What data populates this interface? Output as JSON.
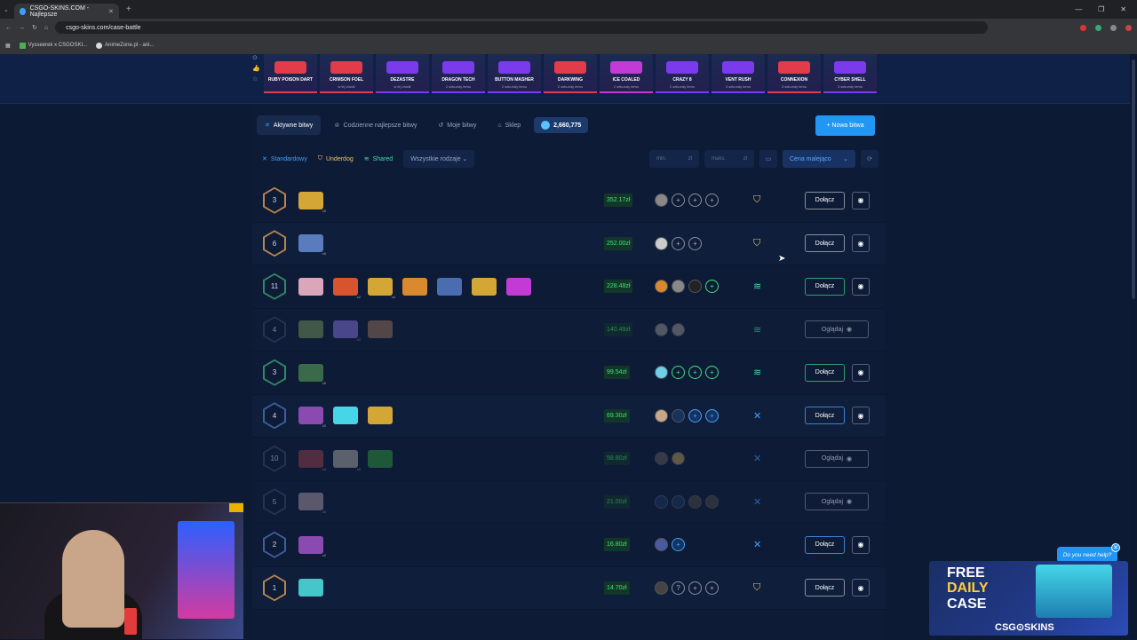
{
  "browser": {
    "tab_title": "CSGO-SKINS.COM - Najlepsze",
    "url": "csgo-skins.com/case-battle",
    "bookmarks": [
      "Vysseerek x CSGOSKI...",
      "AnimeZone.pl - ani..."
    ]
  },
  "live_drops": [
    {
      "name": "RUBY POISON DART",
      "sub": "",
      "color": "#e23b4a"
    },
    {
      "name": "CRIMSON FOEL",
      "sub": "w lej chwili",
      "color": "#e23b4a"
    },
    {
      "name": "DEZASTRE",
      "sub": "w lej chwili",
      "color": "#7c3aed"
    },
    {
      "name": "DRAGON TECH",
      "sub": "2 sekundy temu",
      "color": "#7c3aed"
    },
    {
      "name": "BUTTON MASHER",
      "sub": "2 sekundy temu",
      "color": "#7c3aed"
    },
    {
      "name": "DARKWING",
      "sub": "2 sekundy temu",
      "color": "#e23b4a"
    },
    {
      "name": "ICE COALED",
      "sub": "2 sekundy temu",
      "color": "#c23bd4"
    },
    {
      "name": "CRAZY 8",
      "sub": "2 sekundy temu",
      "color": "#7c3aed"
    },
    {
      "name": "VENT RUSH",
      "sub": "3 sekundy temu",
      "color": "#7c3aed"
    },
    {
      "name": "CONNEXION",
      "sub": "3 sekundy temu",
      "color": "#e23b4a"
    },
    {
      "name": "CYBER SHELL",
      "sub": "3 sekundy temu",
      "color": "#7c3aed"
    }
  ],
  "toolbar": {
    "active_tab": "Aktywne bitwy",
    "tab2": "Codzienne najlepsze bitwy",
    "tab3": "Moje bitwy",
    "tab4": "Sklep",
    "balance": "2,660,775",
    "new_battle": "+ Nowa bitwa"
  },
  "filters": {
    "standard": "Standardowy",
    "underdog": "Underdog",
    "shared": "Shared",
    "type_select": "Wszystkie rodzaje",
    "min": "min.",
    "max": "maks.",
    "currency": "zł",
    "sort": "Cena malejąco"
  },
  "battles": [
    {
      "round": "3",
      "hex": "gold",
      "cases": [
        [
          "#d4a636",
          "x5"
        ]
      ],
      "price": "352.17zł",
      "players": [
        "#888",
        "+",
        "+",
        "+"
      ],
      "mode": "underdog",
      "action": "Dołącz",
      "btn": ""
    },
    {
      "round": "6",
      "hex": "gold",
      "cases": [
        [
          "#5a7bbd",
          "x6"
        ]
      ],
      "price": "252.00zł",
      "players": [
        "#ccc",
        "+",
        "+"
      ],
      "mode": "underdog",
      "action": "Dołącz",
      "btn": ""
    },
    {
      "round": "11",
      "hex": "green",
      "cases": [
        [
          "#d9a7b9",
          ""
        ],
        [
          "#d8542e",
          "x2"
        ],
        [
          "#d4a636",
          "x4"
        ],
        [
          "#d98a2e",
          ""
        ],
        [
          "#4a6db2",
          ""
        ],
        [
          "#d4a636",
          ""
        ],
        [
          "#c23bd4",
          ""
        ]
      ],
      "price": "228.48zł",
      "players": [
        "#d98a2e",
        "#888",
        "#222",
        "+g"
      ],
      "mode": "shared",
      "action": "Dołącz",
      "btn": "g"
    },
    {
      "round": "4",
      "hex": "grey",
      "cases": [
        [
          "#6b8a5a",
          ""
        ],
        [
          "#7b6ad0",
          "x2"
        ],
        [
          "#8a6a5a",
          ""
        ]
      ],
      "price": "140.49zł",
      "players": [
        "#888",
        "#888"
      ],
      "mode": "shared",
      "action": "Oglądaj",
      "btn": "w",
      "dim": true
    },
    {
      "round": "3",
      "hex": "green",
      "cases": [
        [
          "#3a6a4a",
          "x5"
        ]
      ],
      "price": "99.54zł",
      "players": [
        "#6bd0e8",
        "+g",
        "+g",
        "+g"
      ],
      "mode": "shared",
      "action": "Dołącz",
      "btn": "g"
    },
    {
      "round": "4",
      "hex": "blue",
      "cases": [
        [
          "#8a4ab0",
          "x2"
        ],
        [
          "#45d6e8",
          ""
        ],
        [
          "#d4a636",
          ""
        ]
      ],
      "price": "69.30zł",
      "players": [
        "#c9a58a",
        "#16335f",
        "+b",
        "+b"
      ],
      "mode": "standard",
      "action": "Dołącz",
      "btn": "b"
    },
    {
      "round": "10",
      "hex": "grey",
      "cases": [
        [
          "#8a3a4a",
          "x4"
        ],
        [
          "#9a9a9a",
          "x3"
        ],
        [
          "#2e8a3a",
          ""
        ]
      ],
      "price": "58.80zł",
      "players": [
        "#555",
        "#a08a5a"
      ],
      "mode": "standard",
      "action": "Oglądaj",
      "btn": "w",
      "dim": true
    },
    {
      "round": "5",
      "hex": "grey",
      "cases": [
        [
          "#9a8a9a",
          "x5"
        ]
      ],
      "price": "21.00zł",
      "players": [
        "#16335f",
        "#16335f",
        "#444",
        "#444"
      ],
      "mode": "standard",
      "action": "Oglądaj",
      "btn": "w",
      "dim": true
    },
    {
      "round": "2",
      "hex": "blue",
      "cases": [
        [
          "#8a4ab0",
          "x2"
        ]
      ],
      "price": "16.80zł",
      "players": [
        "#4a5aa0",
        "+b"
      ],
      "mode": "standard",
      "action": "Dołącz",
      "btn": "b"
    },
    {
      "round": "1",
      "hex": "gold",
      "cases": [
        [
          "#45c6c8",
          ""
        ]
      ],
      "price": "14.70zł",
      "players": [
        "#444",
        "?",
        "+",
        "+"
      ],
      "mode": "underdog",
      "action": "Dołącz",
      "btn": ""
    }
  ],
  "help": "Do you need help?",
  "promo": {
    "l1": "FREE",
    "l2": "DAILY",
    "l3": "CASE",
    "brand": "CSG⊙SKINS"
  }
}
